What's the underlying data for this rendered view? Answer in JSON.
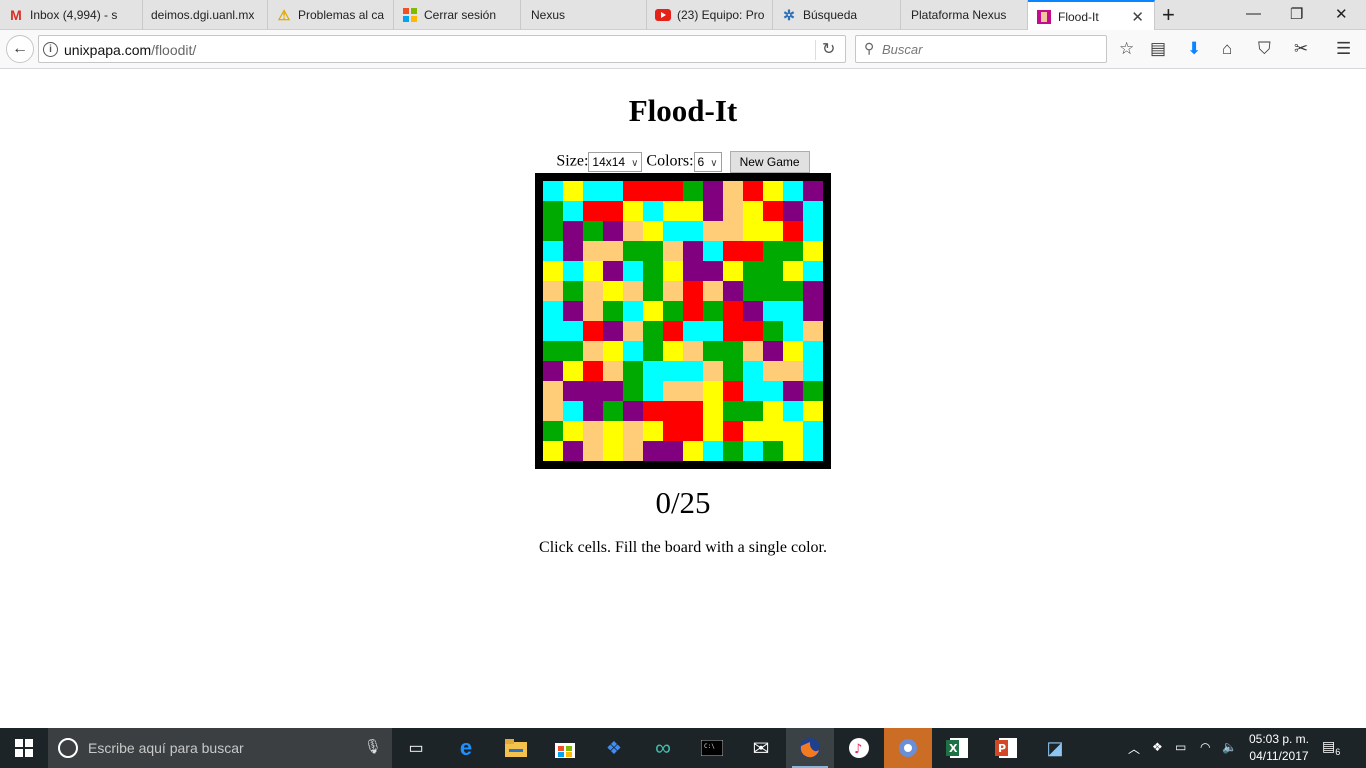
{
  "browser": {
    "tabs": [
      {
        "label": "Inbox (4,994) - s",
        "icon": "gmail-icon"
      },
      {
        "label": "deimos.dgi.uanl.mx",
        "icon": "none"
      },
      {
        "label": "Problemas al ca",
        "icon": "warning-icon"
      },
      {
        "label": "Cerrar sesión",
        "icon": "microsoft-icon"
      },
      {
        "label": "Nexus",
        "icon": "none"
      },
      {
        "label": "(23) Equipo: Pro",
        "icon": "youtube-icon"
      },
      {
        "label": "Búsqueda",
        "icon": "globe-icon"
      },
      {
        "label": "Plataforma Nexus",
        "icon": "none"
      },
      {
        "label": "Flood-It",
        "icon": "flood-it-icon",
        "active": true
      }
    ],
    "url_host": "unixpapa.com",
    "url_path": "/floodit/",
    "search_placeholder": "Buscar"
  },
  "page": {
    "title": "Flood-It",
    "size_label": "Size:",
    "size_value": "14x14",
    "colors_label": "Colors:",
    "colors_value": "6",
    "new_game_label": "New Game",
    "moves": "0/25",
    "instructions": "Click cells. Fill the board with a single color."
  },
  "palette": {
    "C": "#00ffff",
    "Y": "#ffff00",
    "R": "#ff0000",
    "G": "#00aa00",
    "P": "#800080",
    "O": "#ffcc77"
  },
  "board": [
    "CYCCRRRGPORYCP",
    "GCRRYCYYPOYRP",
    "GPGPOYCCOOYYR",
    "CPOOGGOPCRRGGY",
    "YCYPCGYPPYGGYC",
    "OGOYOGOROPGGGP",
    "CPOGCYGRGRPCCP",
    "CCRPOGRCCRRGCO",
    "GGOYCGYOGGOPYC",
    "PYROGCCCOGCOOC",
    "OPPPGCOOYRCCPG",
    "OCPGPRRRYGGYCY",
    "GYOYOYRRYRYYYC",
    "YPOYOPPYCGCGYC"
  ],
  "taskbar": {
    "search_placeholder": "Escribe aquí para buscar",
    "time": "05:03 p. m.",
    "date": "04/11/2017",
    "notification_count": "6"
  }
}
